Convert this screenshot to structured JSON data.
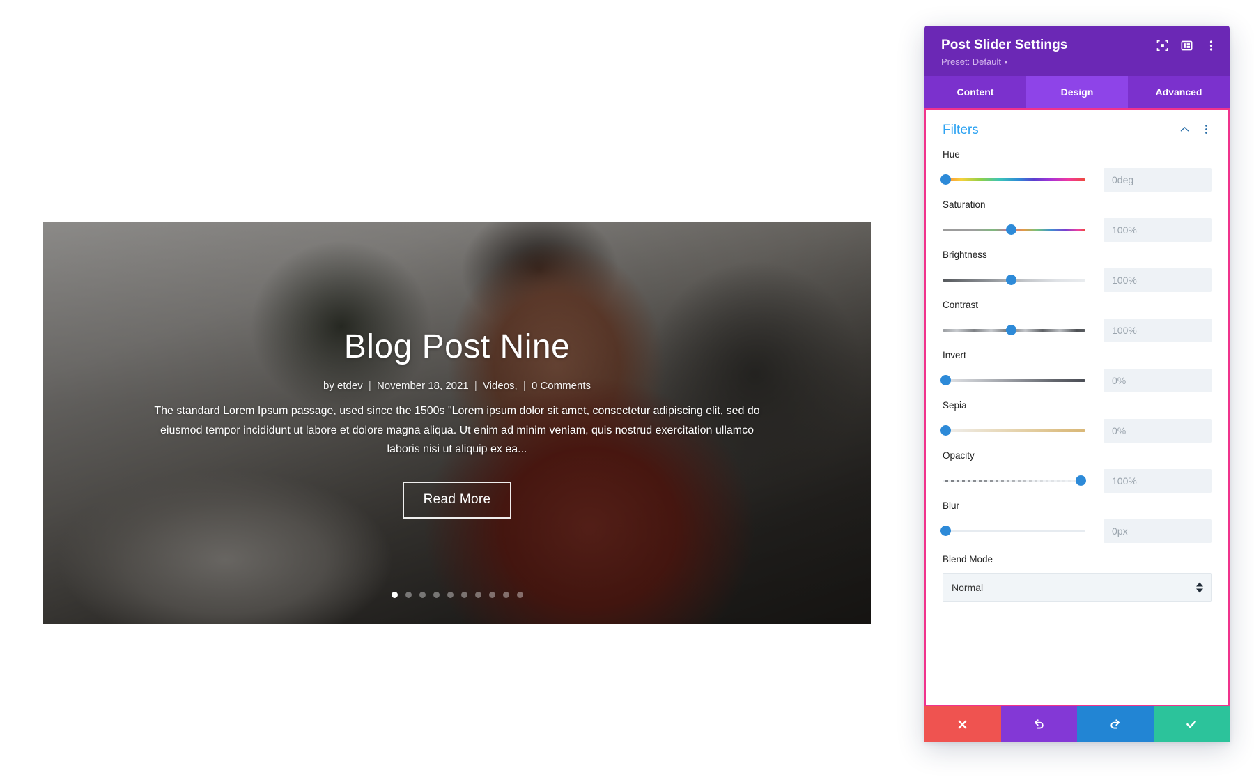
{
  "page": {
    "background_color": "#f7fbfd"
  },
  "slider": {
    "title": "Blog Post Nine",
    "meta": {
      "author": "by etdev",
      "date": "November 18, 2021",
      "category": "Videos,",
      "comments": "0 Comments",
      "separator": "|"
    },
    "excerpt": "The standard Lorem Ipsum passage, used since the 1500s \"Lorem ipsum dolor sit amet, consectetur adipiscing elit, sed do eiusmod tempor incididunt ut labore et dolore magna aliqua. Ut enim ad minim veniam, quis nostrud exercitation ullamco laboris nisi ut aliquip ex ea...",
    "read_more_label": "Read More",
    "dots": {
      "count": 10,
      "active_index": 0
    }
  },
  "modal": {
    "title": "Post Slider Settings",
    "preset_label": "Preset: Default",
    "header_icons": [
      {
        "name": "focus-icon"
      },
      {
        "name": "layout-panel-icon"
      },
      {
        "name": "more-vertical-icon"
      }
    ],
    "tabs": [
      {
        "label": "Content",
        "active": false
      },
      {
        "label": "Design",
        "active": true
      },
      {
        "label": "Advanced",
        "active": false
      }
    ],
    "accent_colors": {
      "header_purple": "#6b28b5",
      "tab_active": "#8e44e8",
      "border_pink": "#f0338c",
      "section_title_blue": "#2ea3f2",
      "slider_knob_blue": "#2d8ad8"
    },
    "section": {
      "title": "Filters",
      "collapsed": false,
      "fields": [
        {
          "label": "Hue",
          "value": "0deg",
          "knob_percent": 2,
          "track": "t-hue"
        },
        {
          "label": "Saturation",
          "value": "100%",
          "knob_percent": 48,
          "track": "t-sat"
        },
        {
          "label": "Brightness",
          "value": "100%",
          "knob_percent": 48,
          "track": "t-bri"
        },
        {
          "label": "Contrast",
          "value": "100%",
          "knob_percent": 48,
          "track": "t-con"
        },
        {
          "label": "Invert",
          "value": "0%",
          "knob_percent": 2,
          "track": "t-inv"
        },
        {
          "label": "Sepia",
          "value": "0%",
          "knob_percent": 2,
          "track": "t-sep"
        },
        {
          "label": "Opacity",
          "value": "100%",
          "knob_percent": 97,
          "track": "t-opa"
        },
        {
          "label": "Blur",
          "value": "0px",
          "knob_percent": 2,
          "track": "t-blur"
        }
      ],
      "blend_mode": {
        "label": "Blend Mode",
        "selected": "Normal"
      }
    },
    "footer_buttons": [
      {
        "name": "cancel-button",
        "icon": "close-icon",
        "color": "#ef5350"
      },
      {
        "name": "undo-button",
        "icon": "undo-icon",
        "color": "#8338d6"
      },
      {
        "name": "redo-button",
        "icon": "redo-icon",
        "color": "#2285d4"
      },
      {
        "name": "save-button",
        "icon": "check-icon",
        "color": "#2cc39b"
      }
    ]
  }
}
